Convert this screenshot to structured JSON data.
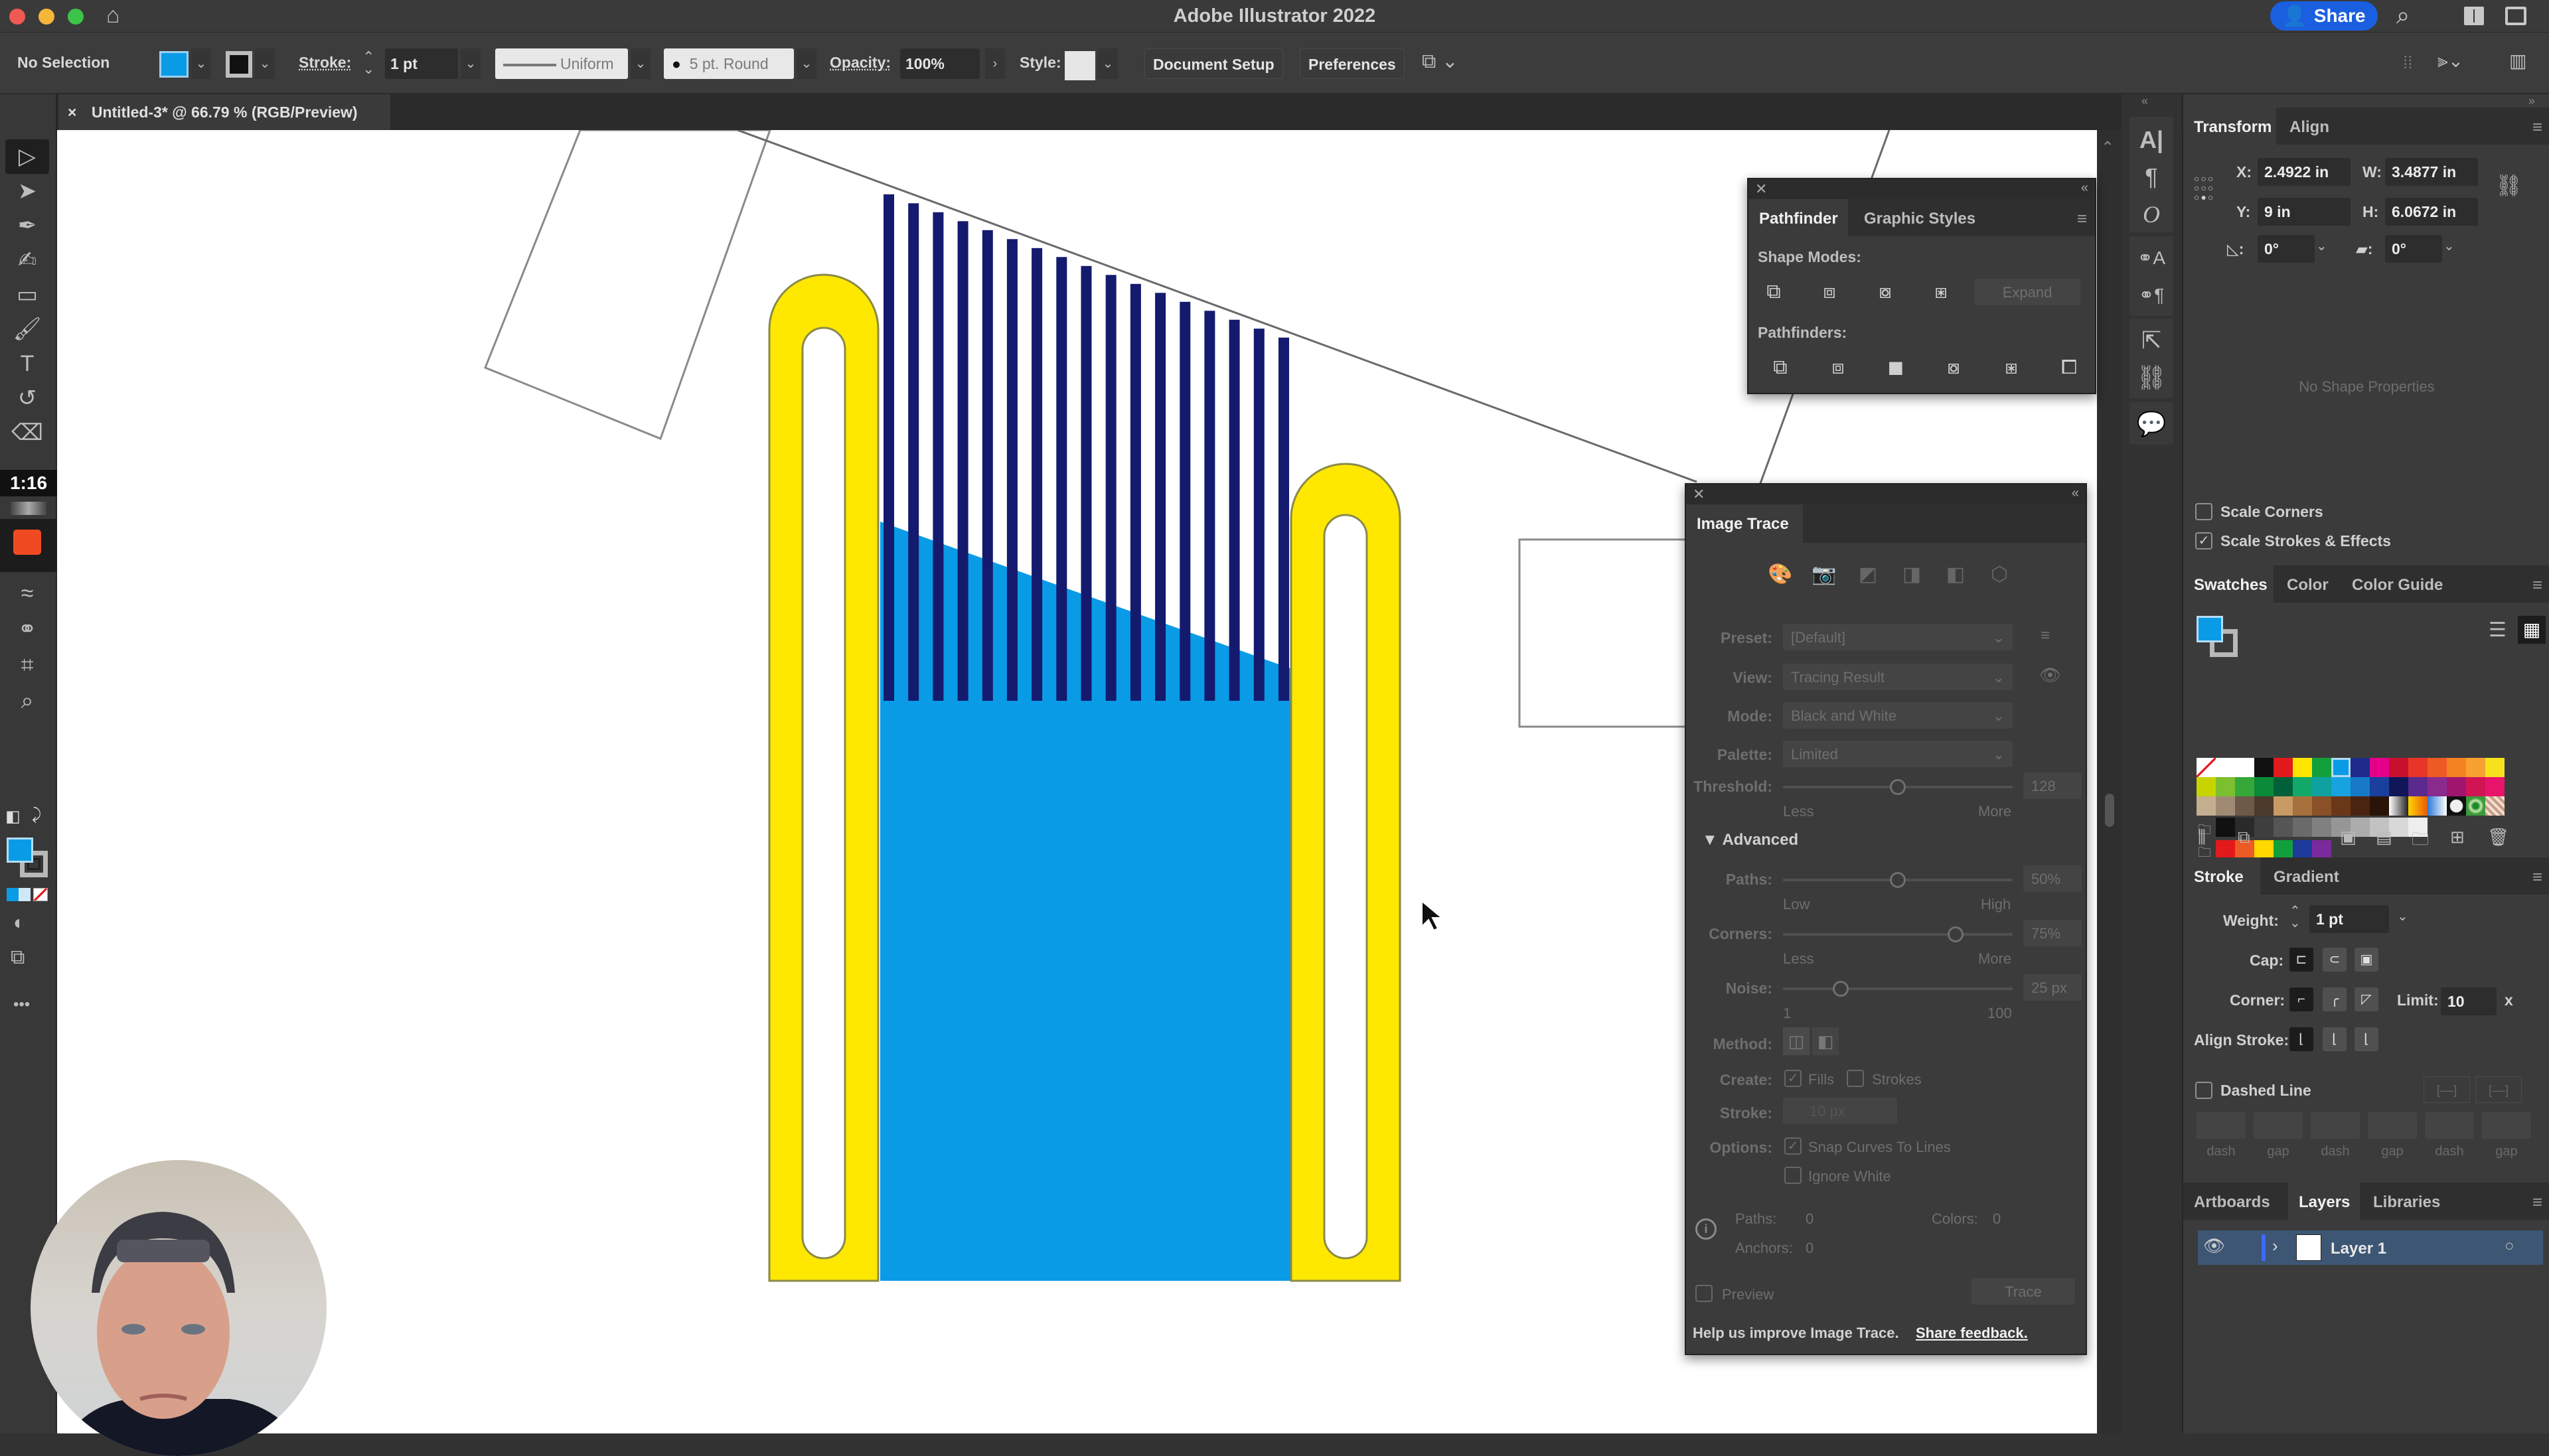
{
  "app": {
    "title": "Adobe Illustrator 2022",
    "share_label": "Share",
    "traffic_colors": {
      "close": "#ee5a52",
      "min": "#f6b63a",
      "max": "#3cc34a"
    }
  },
  "control_bar": {
    "selection": "No Selection",
    "fill_color": "#0a9be6",
    "stroke_label": "Stroke:",
    "stroke_weight": "1 pt",
    "profile": "Uniform",
    "brush": "5 pt. Round",
    "opacity_label": "Opacity:",
    "opacity": "100%",
    "style_label": "Style:",
    "document_setup": "Document Setup",
    "preferences": "Preferences"
  },
  "document_tab": {
    "title": "Untitled-3* @ 66.79 % (RGB/Preview)",
    "close": "×"
  },
  "toolbar": {
    "timer": "1:16",
    "tools": [
      {
        "name": "selection-tool",
        "glyph": "▷"
      },
      {
        "name": "direct-selection-tool",
        "glyph": "➤"
      },
      {
        "name": "pen-tool",
        "glyph": "✒"
      },
      {
        "name": "curvature-tool",
        "glyph": "✍"
      },
      {
        "name": "rectangle-tool",
        "glyph": "▭"
      },
      {
        "name": "paintbrush-tool",
        "glyph": "🖌"
      },
      {
        "name": "type-tool",
        "glyph": "T"
      },
      {
        "name": "rotate-tool",
        "glyph": "↺"
      },
      {
        "name": "eraser-tool",
        "glyph": "⌫"
      }
    ],
    "tools_lower": [
      {
        "name": "width-tool",
        "glyph": "≈"
      },
      {
        "name": "shape-builder-tool",
        "glyph": "⚭"
      },
      {
        "name": "artboard-tool",
        "glyph": "⌗"
      },
      {
        "name": "zoom-tool",
        "glyph": "⌕"
      }
    ],
    "more": "•••"
  },
  "right_strip": {
    "icons": [
      "character-icon",
      "paragraph-icon",
      "opentype-icon",
      "character-styles-icon",
      "paragraph-styles-icon",
      "export-icon",
      "links-icon",
      "comments-icon"
    ]
  },
  "transform": {
    "tabs": [
      "Transform",
      "Align"
    ],
    "x_label": "X:",
    "x": "2.4922 in",
    "y_label": "Y:",
    "y": "9 in",
    "w_label": "W:",
    "w": "3.4877 in",
    "h_label": "H:",
    "h": "6.0672 in",
    "rotate": "0°",
    "shear": "0°",
    "no_shape": "No Shape Properties",
    "scale_corners": "Scale Corners",
    "scale_corners_checked": false,
    "scale_strokes": "Scale Strokes & Effects",
    "scale_strokes_checked": true
  },
  "swatches": {
    "tabs": [
      "Swatches",
      "Color",
      "Color Guide"
    ],
    "rows": [
      [
        "none",
        "#ffffff",
        "#ffffff",
        "#111111",
        "#e31a1c",
        "#ffe600",
        "#12a03c",
        "#0a9be6",
        "#1d2a8c",
        "#e5008a",
        "#c8102e",
        "#e8352a",
        "#ee5a24",
        "#f58220",
        "#f7a131",
        "#f6e21c"
      ],
      [
        "#c8d400",
        "#7cbf2f",
        "#36a83a",
        "#0b8a3a",
        "#00603a",
        "#12a86a",
        "#0fa0a0",
        "#16a3e0",
        "#1679c8",
        "#1a3f9c",
        "#111659",
        "#5a2a8e",
        "#8a2a8e",
        "#a0166e",
        "#d11554",
        "#e8146c"
      ],
      [
        "#c4ae90",
        "#a08a74",
        "#6e5a48",
        "#4c3a2c",
        "#c89a64",
        "#a8703c",
        "#8a5028",
        "#6a3818",
        "#4a2410",
        "#2a1408",
        "grad-gray",
        "grad-orange",
        "grad-blue",
        "radial",
        "pattern-green",
        "pattern-brown"
      ]
    ],
    "gray_row": [
      "#111111",
      "#2a2a2a",
      "#3e3e3e",
      "#555555",
      "#6a6a6a",
      "#808080",
      "#969696",
      "#acacac",
      "#c2c2c2",
      "#d8d8d8",
      "#eeeeee"
    ],
    "color_group": [
      "#e31a1c",
      "#ee5a24",
      "#ffd800",
      "#12a03c",
      "#1d3a9c",
      "#7a2a9c"
    ]
  },
  "stroke_panel": {
    "tabs": [
      "Stroke",
      "Gradient"
    ],
    "weight_label": "Weight:",
    "weight": "1 pt",
    "cap_label": "Cap:",
    "corner_label": "Corner:",
    "limit_label": "Limit:",
    "limit": "10",
    "limit_unit": "x",
    "align_label": "Align Stroke:",
    "dashed_line": "Dashed Line",
    "dashed_checked": false,
    "dash_labels": [
      "dash",
      "gap",
      "dash",
      "gap",
      "dash",
      "gap"
    ]
  },
  "layers_panel": {
    "tabs": [
      "Artboards",
      "Layers",
      "Libraries"
    ],
    "layers": [
      {
        "name": "Layer 1",
        "visible": true,
        "color": "#3a6aff"
      }
    ]
  },
  "pathfinder": {
    "tabs": [
      "Pathfinder",
      "Graphic Styles"
    ],
    "shape_modes_label": "Shape Modes:",
    "pathfinders_label": "Pathfinders:",
    "expand": "Expand",
    "shape_modes": [
      "unite-icon",
      "minus-front-icon",
      "intersect-icon",
      "exclude-icon"
    ],
    "pathfinders": [
      "divide-icon",
      "trim-icon",
      "merge-icon",
      "crop-icon",
      "outline-icon",
      "minus-back-icon"
    ]
  },
  "image_trace": {
    "title": "Image Trace",
    "presets_icons": [
      "auto-color-icon",
      "high-color-icon",
      "low-color-icon",
      "grayscale-icon",
      "black-white-icon",
      "outline-icon"
    ],
    "preset_label": "Preset:",
    "preset": "[Default]",
    "view_label": "View:",
    "view": "Tracing Result",
    "mode_label": "Mode:",
    "mode": "Black and White",
    "palette_label": "Palette:",
    "palette": "Limited",
    "threshold_label": "Threshold:",
    "threshold": "128",
    "threshold_fraction": 0.5,
    "less": "Less",
    "more": "More",
    "advanced": "Advanced",
    "paths_label": "Paths:",
    "paths": "50%",
    "paths_fraction": 0.5,
    "low": "Low",
    "high": "High",
    "corners_label": "Corners:",
    "corners": "75%",
    "corners_fraction": 0.75,
    "noise_label": "Noise:",
    "noise": "25 px",
    "noise_fraction": 0.25,
    "noise_min": "1",
    "noise_max": "100",
    "method_label": "Method:",
    "create_label": "Create:",
    "fills": "Fills",
    "fills_checked": true,
    "strokes": "Strokes",
    "strokes_checked": false,
    "stroke_label": "Stroke:",
    "stroke": "10 px",
    "options_label": "Options:",
    "snap": "Snap Curves To Lines",
    "snap_checked": true,
    "ignore_white": "Ignore White",
    "ignore_checked": false,
    "stat_paths_label": "Paths:",
    "stat_paths": "0",
    "stat_colors_label": "Colors:",
    "stat_colors": "0",
    "stat_anchors_label": "Anchors:",
    "stat_anchors": "0",
    "preview": "Preview",
    "preview_checked": false,
    "trace": "Trace",
    "help": "Help us improve Image Trace.",
    "feedback": "Share feedback."
  },
  "artwork": {
    "yellow": "#ffe800",
    "blue": "#0a9be6",
    "navy": "#141a6e",
    "stripe_count": 17
  }
}
